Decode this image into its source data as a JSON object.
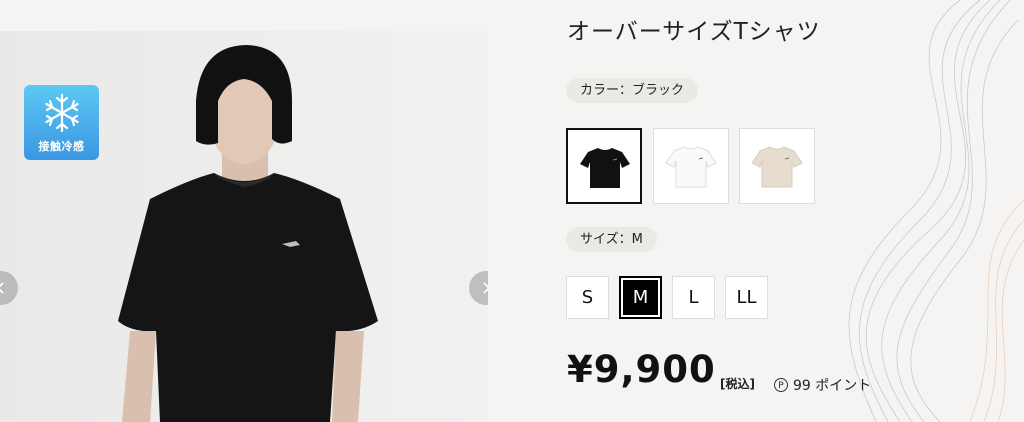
{
  "product": {
    "title": "オーバーサイズTシャツ"
  },
  "gallery": {
    "badge_label": "接触冷感",
    "badge_icon": "snowflake-icon",
    "prev_icon": "chevron-left-icon",
    "next_icon": "chevron-right-icon"
  },
  "color": {
    "label": "カラー：ブラック",
    "options": [
      {
        "name": "black",
        "hex": "#111111",
        "selected": true
      },
      {
        "name": "white",
        "hex": "#ffffff",
        "selected": false
      },
      {
        "name": "beige",
        "hex": "#e6ddd0",
        "selected": false
      }
    ]
  },
  "size": {
    "label": "サイズ：M",
    "options": [
      {
        "label": "S",
        "selected": false
      },
      {
        "label": "M",
        "selected": true
      },
      {
        "label": "L",
        "selected": false
      },
      {
        "label": "LL",
        "selected": false
      }
    ]
  },
  "price": {
    "amount": "¥9,900",
    "tax_label": "[税込]",
    "points_icon": "P",
    "points_text": "99 ポイント"
  },
  "colors": {
    "badge_top": "#5dc8f3",
    "badge_bottom": "#3a97e3",
    "selected_border": "#111111",
    "background": "#f5f4f2"
  }
}
